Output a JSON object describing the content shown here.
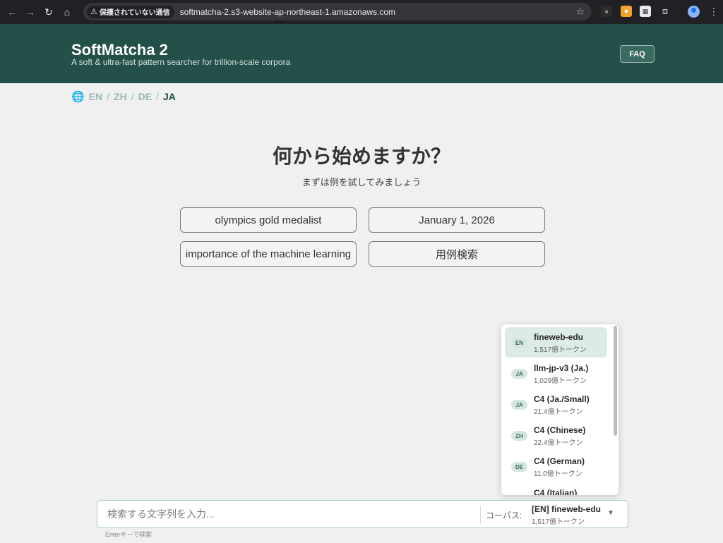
{
  "browser": {
    "security_chip": "保護されていない通信",
    "url": "softmatcha-2.s3-website-ap-northeast-1.amazonaws.com"
  },
  "header": {
    "title": "SoftMatcha 2",
    "subtitle": "A soft & ultra-fast pattern searcher for trillion-scale corpora",
    "faq_label": "FAQ"
  },
  "languages": {
    "items": [
      "EN",
      "ZH",
      "DE",
      "JA"
    ],
    "active": "JA",
    "separator": "/"
  },
  "hero": {
    "title": "何から始めますか？",
    "subtitle": "まずは例を試してみましょう"
  },
  "examples": [
    "olympics gold medalist",
    "January 1, 2026",
    "importance of the machine learning",
    "用例検索"
  ],
  "corpora": [
    {
      "lang": "EN",
      "name": "fineweb-edu",
      "count": "1,517億トークン",
      "selected": true
    },
    {
      "lang": "JA",
      "name": "llm-jp-v3 (Ja.)",
      "count": "1,029億トークン"
    },
    {
      "lang": "JA",
      "name": "C4 (Ja./Small)",
      "count": "21.4億トークン"
    },
    {
      "lang": "ZH",
      "name": "C4 (Chinese)",
      "count": "22.4億トークン"
    },
    {
      "lang": "DE",
      "name": "C4 (German)",
      "count": "11.0億トークン"
    },
    {
      "lang": "",
      "name": "C4 (Italian)",
      "count": ""
    }
  ],
  "search": {
    "placeholder": "検索する文字列を入力...",
    "corpus_label": "コーパス:",
    "selected_corpus": "[EN] fineweb-edu",
    "selected_count": "1,517億トークン",
    "hint": "Enterキーで検索"
  }
}
